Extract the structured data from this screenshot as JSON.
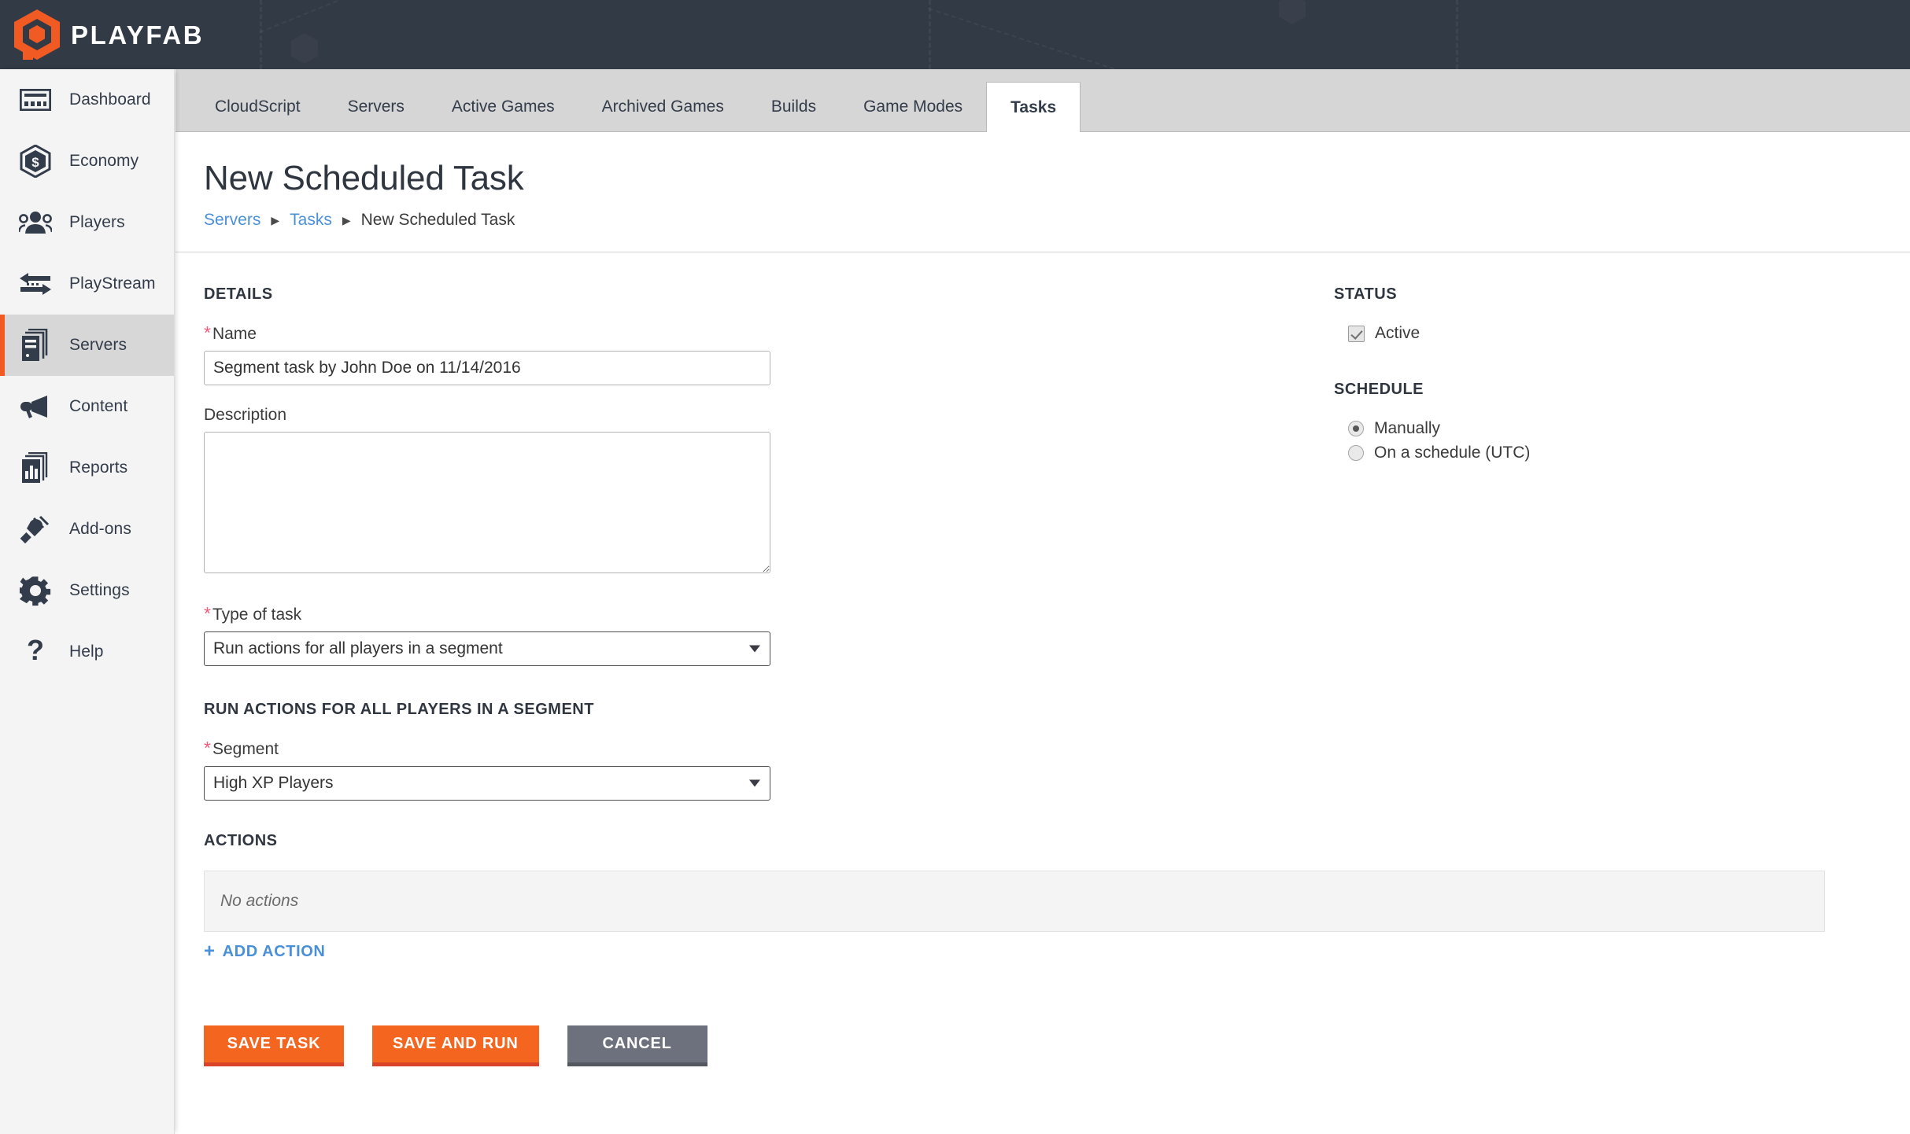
{
  "brand": {
    "name": "PLAYFAB",
    "logo_icon": "playfab-hexagon-logo",
    "accent_color": "#f15a22"
  },
  "sidebar": {
    "items": [
      {
        "label": "Dashboard",
        "icon": "dashboard-icon",
        "active": false
      },
      {
        "label": "Economy",
        "icon": "economy-coin-icon",
        "active": false
      },
      {
        "label": "Players",
        "icon": "players-group-icon",
        "active": false
      },
      {
        "label": "PlayStream",
        "icon": "playstream-arrows-icon",
        "active": false
      },
      {
        "label": "Servers",
        "icon": "servers-stack-icon",
        "active": true
      },
      {
        "label": "Content",
        "icon": "content-megaphone-icon",
        "active": false
      },
      {
        "label": "Reports",
        "icon": "reports-chart-icon",
        "active": false
      },
      {
        "label": "Add-ons",
        "icon": "addons-plug-icon",
        "active": false
      },
      {
        "label": "Settings",
        "icon": "settings-gear-icon",
        "active": false
      },
      {
        "label": "Help",
        "icon": "help-question-icon",
        "active": false
      }
    ]
  },
  "tabs": [
    {
      "label": "CloudScript",
      "active": false
    },
    {
      "label": "Servers",
      "active": false
    },
    {
      "label": "Active Games",
      "active": false
    },
    {
      "label": "Archived Games",
      "active": false
    },
    {
      "label": "Builds",
      "active": false
    },
    {
      "label": "Game Modes",
      "active": false
    },
    {
      "label": "Tasks",
      "active": true
    }
  ],
  "page": {
    "title": "New Scheduled Task",
    "breadcrumb": [
      {
        "label": "Servers",
        "link": true
      },
      {
        "label": "Tasks",
        "link": true
      },
      {
        "label": "New Scheduled Task",
        "link": false
      }
    ],
    "breadcrumb_separator": "▶"
  },
  "details": {
    "section_title": "DETAILS",
    "name": {
      "label": "Name",
      "required_marker": "*",
      "value": "Segment task by John Doe on 11/14/2016",
      "placeholder": ""
    },
    "description": {
      "label": "Description",
      "value": "",
      "placeholder": ""
    },
    "type_of_task": {
      "label": "Type of task",
      "required_marker": "*",
      "selected": "Run actions for all players in a segment"
    }
  },
  "segment_section": {
    "section_title": "RUN ACTIONS FOR ALL PLAYERS IN A SEGMENT",
    "segment": {
      "label": "Segment",
      "required_marker": "*",
      "selected": "High XP Players"
    }
  },
  "actions_section": {
    "section_title": "ACTIONS",
    "empty_text": "No actions",
    "add_action_label": "ADD ACTION",
    "add_action_icon": "plus-icon"
  },
  "footer_buttons": {
    "save_task": "SAVE TASK",
    "save_and_run": "SAVE AND RUN",
    "cancel": "CANCEL",
    "primary_color": "#f4651f",
    "secondary_color": "#6d717e"
  },
  "status": {
    "section_title": "STATUS",
    "active_label": "Active",
    "active_checked": true
  },
  "schedule": {
    "section_title": "SCHEDULE",
    "options": [
      {
        "label": "Manually",
        "selected": true
      },
      {
        "label": "On a schedule (UTC)",
        "selected": false
      }
    ]
  }
}
